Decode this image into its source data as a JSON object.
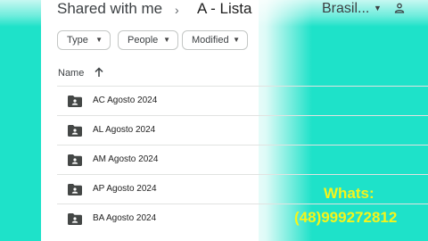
{
  "header": {
    "breadcrumb_root": "Shared with me",
    "breadcrumb_separator": "›",
    "current_folder": "A - Lista",
    "language": "Brasil...",
    "icons": {
      "language_dropdown": "caret-down-icon",
      "account": "person-icon"
    }
  },
  "filters": [
    {
      "label": "Type"
    },
    {
      "label": "People"
    },
    {
      "label": "Modified"
    }
  ],
  "column": {
    "name_label": "Name",
    "sort_icon": "arrow-up-icon"
  },
  "files": [
    {
      "name": "AC Agosto 2024",
      "icon": "shared-folder-icon"
    },
    {
      "name": "AL Agosto 2024",
      "icon": "shared-folder-icon"
    },
    {
      "name": "AM Agosto 2024",
      "icon": "shared-folder-icon"
    },
    {
      "name": "AP Agosto 2024",
      "icon": "shared-folder-icon"
    },
    {
      "name": "BA Agosto 2024",
      "icon": "shared-folder-icon"
    }
  ],
  "overlay": {
    "line1": "Whats:",
    "line2": "(48)999272812"
  },
  "colors": {
    "background": "#1ee2c9",
    "overlay_text": "#f5f51a",
    "panel": "#ffffff"
  }
}
